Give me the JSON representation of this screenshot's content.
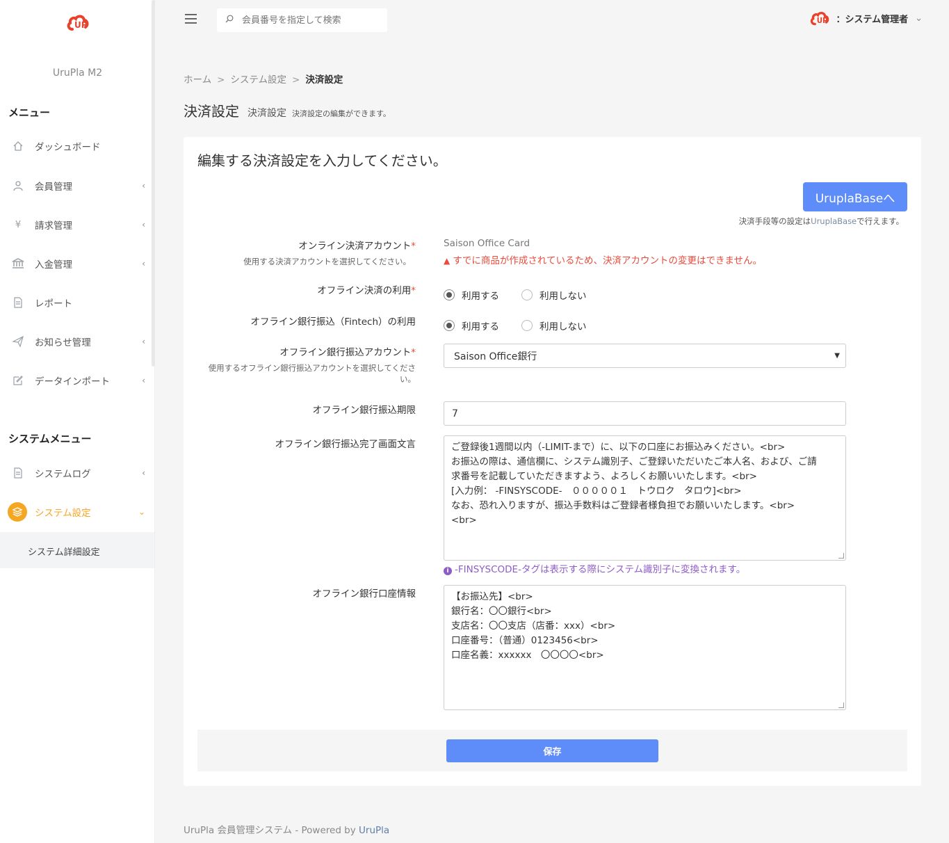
{
  "sidebar": {
    "brand": "UruPla M2",
    "menu_heading": "メニュー",
    "items": [
      {
        "label": "ダッシュボード",
        "icon": "home-icon"
      },
      {
        "label": "会員管理",
        "icon": "user-icon"
      },
      {
        "label": "請求管理",
        "icon": "yen-icon"
      },
      {
        "label": "入金管理",
        "icon": "bank-icon"
      },
      {
        "label": "レポート",
        "icon": "document-icon"
      },
      {
        "label": "お知らせ管理",
        "icon": "paper-plane-icon"
      },
      {
        "label": "データインポート",
        "icon": "edit-icon"
      }
    ],
    "system_heading": "システムメニュー",
    "system_items": [
      {
        "label": "システムログ",
        "icon": "document-icon"
      },
      {
        "label": "システム設定",
        "icon": "layers-icon"
      }
    ],
    "sub_item": "システム詳細設定",
    "active_color": "#f5a623"
  },
  "header": {
    "search_placeholder": "会員番号を指定して検索",
    "user_label": "：システム管理者"
  },
  "breadcrumb": {
    "home": "ホーム",
    "sep": ">",
    "level1": "システム設定",
    "current": "決済設定"
  },
  "title": {
    "main": "決済設定",
    "sub": "決済設定",
    "desc": "決済設定の編集ができます。"
  },
  "card": {
    "heading": "編集する決済設定を入力してください。",
    "urupla_button": "UruplaBaseへ",
    "urupla_note_pre": "決済手段等の設定は",
    "urupla_note_hl": "UruplaBase",
    "urupla_note_post": "で行えます。"
  },
  "form": {
    "online_account": {
      "label": "オンライン決済アカウント",
      "sublabel": "使用する決済アカウントを選択してください。",
      "value": "Saison Office Card",
      "warning": "すでに商品が作成されているため、決済アカウントの変更はできません。"
    },
    "offline_use": {
      "label": "オフライン決済の利用",
      "opt_yes": "利用する",
      "opt_no": "利用しない"
    },
    "fintech_use": {
      "label": "オフライン銀行振込（Fintech）の利用",
      "opt_yes": "利用する",
      "opt_no": "利用しない"
    },
    "bank_account": {
      "label": "オフライン銀行振込アカウント",
      "sublabel_1": "使用するオフライン銀行振込アカウントを選択してくださ",
      "sublabel_2": "い。",
      "selected": "Saison Office銀行"
    },
    "deadline": {
      "label": "オフライン銀行振込期限",
      "value": "7"
    },
    "complete_text": {
      "label": "オフライン銀行振込完了画面文言",
      "lines": [
        "ご登録後1週間以内（-LIMIT-まで）に、以下の口座にお振込みください。<br>",
        "お振込の際は、通信欄に、システム識別子、ご登録いただいたご本人名、および、ご請",
        "求番号を記載していただきますよう、よろしくお願いいたします。<br>",
        "[入力例： -FINSYSCODE-　０００００１　トウロク　タロウ]<br>",
        "なお、恐れ入りますが、振込手数料はご登録者様負担でお願いいたします。<br>",
        "<br>"
      ],
      "note": "-FINSYSCODE-タグは表示する際にシステム識別子に変換されます。"
    },
    "account_info": {
      "label": "オフライン銀行口座情報",
      "lines": [
        "【お振込先】<br>",
        "銀行名：〇〇銀行<br>",
        "支店名：〇〇支店（店番：xxx）<br>",
        "口座番号：（普通）0123456<br>",
        "口座名義：xxxxxx　〇〇〇〇<br>"
      ]
    },
    "save_button": "保存"
  },
  "footer": {
    "text": "UruPla 会員管理システム - Powered by ",
    "link": "UruPla"
  }
}
